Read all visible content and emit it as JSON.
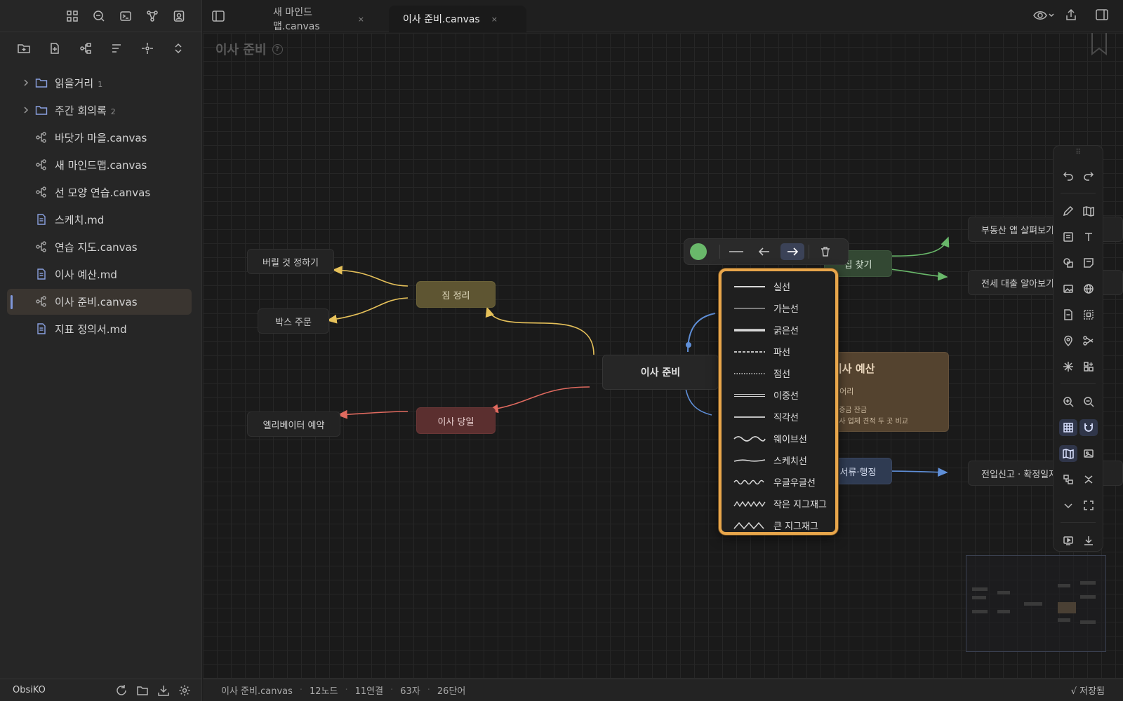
{
  "app": {
    "vault_name": "ObsiKO"
  },
  "tabs": [
    {
      "label": "새 마인드맵.canvas",
      "close": "×"
    },
    {
      "label": "이사 준비.canvas",
      "close": "×"
    }
  ],
  "file_tree": [
    {
      "label": "읽을거리",
      "count": "1",
      "type": "folder"
    },
    {
      "label": "주간 회의록",
      "count": "2",
      "type": "folder"
    },
    {
      "label": "바닷가 마을.canvas",
      "type": "canvas"
    },
    {
      "label": "새 마인드맵.canvas",
      "type": "canvas"
    },
    {
      "label": "선 모양 연습.canvas",
      "type": "canvas"
    },
    {
      "label": "스케치.md",
      "type": "markdown"
    },
    {
      "label": "연습 지도.canvas",
      "type": "canvas"
    },
    {
      "label": "이사 예산.md",
      "type": "markdown"
    },
    {
      "label": "이사 준비.canvas",
      "type": "canvas",
      "active": true
    },
    {
      "label": "지표 정의서.md",
      "type": "markdown"
    }
  ],
  "canvas": {
    "title": "이사 준비",
    "help": "?",
    "nodes": {
      "center": "이사 준비",
      "pack": "짐 정리",
      "discard": "버릴 것 정하기",
      "box": "박스 주문",
      "moving_day": "이사 당일",
      "elevator": "엘리베이터 예약",
      "house": "집 찾기",
      "realestate_app": "부동산 앱 살펴보기",
      "loan": "전세 대출 알아보기",
      "paperwork": "서류·행정",
      "move_in_report": "전입신고 · 확정일자",
      "budget_title": "이사 예산",
      "budget_sub": "덩어리",
      "budget_line1": "보증금 잔금",
      "budget_line2": "이사 업체 견적 두 곳 비교"
    }
  },
  "edge_toolbar": {
    "color": "#69b86a",
    "active": "arrow-right"
  },
  "line_styles": [
    "실선",
    "가는선",
    "굵은선",
    "파선",
    "점선",
    "이중선",
    "직각선",
    "웨이브선",
    "스케치선",
    "우글우글선",
    "작은 지그재그",
    "큰 지그재그"
  ],
  "status": {
    "file": "이사 준비.canvas",
    "nodes": "12노드",
    "edges": "11연결",
    "chars": "63자",
    "words": "26단어",
    "saved": "√ 저장됨"
  },
  "colors": {
    "accent": "#7f96d8",
    "yellow_edge": "#e6c15a",
    "red_edge": "#e06a5f",
    "green_edge": "#69b86a",
    "blue_edge": "#5f8fd8",
    "menu_border": "#e8a64b"
  }
}
